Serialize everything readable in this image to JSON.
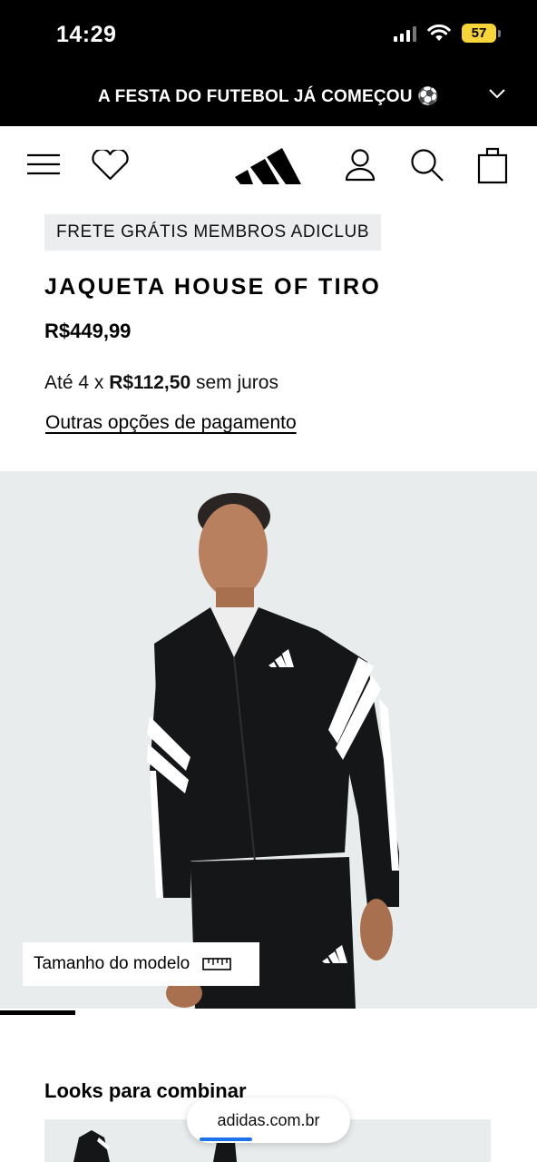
{
  "status_bar": {
    "time": "14:29",
    "battery": "57"
  },
  "promo": {
    "text": "A FESTA DO FUTEBOL JÁ COMEÇOU ⚽"
  },
  "header": {
    "icons": [
      "menu-icon",
      "heart-icon",
      "adidas-logo",
      "account-icon",
      "search-icon",
      "bag-icon"
    ]
  },
  "product": {
    "badge": "FRETE GRÁTIS MEMBROS ADICLUB",
    "title": "JAQUETA HOUSE OF TIRO",
    "price": "R$449,99",
    "installments_prefix": "Até 4 x ",
    "installments_value": "R$112,50",
    "installments_suffix": " sem juros",
    "payment_link": "Outras opções de pagamento",
    "model_size_label": "Tamanho do modelo",
    "gallery_progress": 0.14
  },
  "looks": {
    "title": "Looks para combinar"
  },
  "browser": {
    "url": "adidas.com.br"
  },
  "colors": {
    "bar_bg": "#000000",
    "image_bg": "#e9ecec",
    "badge_bg": "#ebedee",
    "battery": "#f7d43a"
  }
}
